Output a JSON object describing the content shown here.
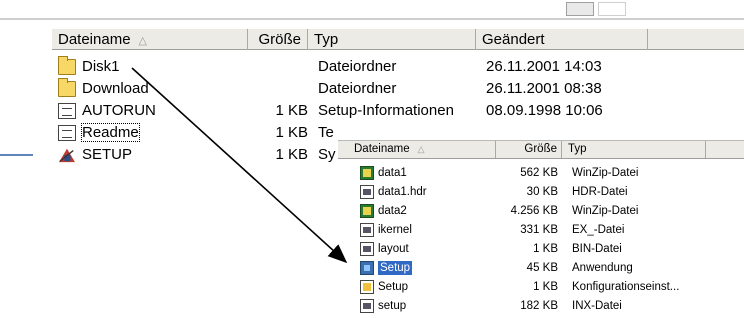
{
  "main": {
    "columns": [
      "Dateiname",
      "Größe",
      "Typ",
      "Geändert"
    ],
    "sort_indicator": "△",
    "rows": [
      {
        "name": "Disk1",
        "size": "",
        "type": "Dateiordner",
        "date": "26.11.2001 14:03",
        "icon": "folder-icon"
      },
      {
        "name": "Download",
        "size": "",
        "type": "Dateiordner",
        "date": "26.11.2001 08:38",
        "icon": "folder-icon"
      },
      {
        "name": "AUTORUN",
        "size": "1 KB",
        "type": "Setup-Informationen",
        "date": "08.09.1998 10:06",
        "icon": "setup-info-icon"
      },
      {
        "name": "Readme",
        "size": "1 KB",
        "type": "Te",
        "date": "",
        "icon": "text-document-icon"
      },
      {
        "name": "SETUP",
        "size": "1 KB",
        "type": "Sy",
        "date": "",
        "icon": "setup-program-icon"
      }
    ]
  },
  "overlay": {
    "columns": [
      "Dateiname",
      "Größe",
      "Typ"
    ],
    "sort_indicator": "△",
    "rows": [
      {
        "name": "data1",
        "size": "562 KB",
        "type": "WinZip-Datei",
        "icon": "winzip-icon"
      },
      {
        "name": "data1.hdr",
        "size": "30 KB",
        "type": "HDR-Datei",
        "icon": "file-icon"
      },
      {
        "name": "data2",
        "size": "4.256 KB",
        "type": "WinZip-Datei",
        "icon": "winzip-icon"
      },
      {
        "name": "ikernel",
        "size": "331 KB",
        "type": "EX_-Datei",
        "icon": "file-icon"
      },
      {
        "name": "layout",
        "size": "1 KB",
        "type": "BIN-Datei",
        "icon": "file-icon"
      },
      {
        "name": "Setup",
        "size": "45 KB",
        "type": "Anwendung",
        "icon": "application-icon"
      },
      {
        "name": "Setup",
        "size": "1 KB",
        "type": "Konfigurationseinst...",
        "icon": "config-file-icon"
      },
      {
        "name": "setup",
        "size": "182 KB",
        "type": "INX-Datei",
        "icon": "file-icon"
      }
    ]
  },
  "colors": {
    "header_bg": "#ecebe6",
    "selection": "#316ac5",
    "arrow": "#000000"
  }
}
